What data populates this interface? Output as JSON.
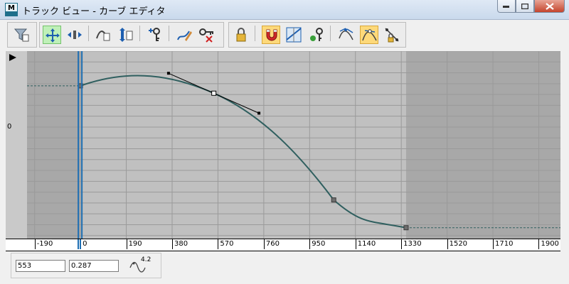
{
  "window": {
    "title": "トラック ビュー - カーブ エディタ",
    "icon_letter": "M"
  },
  "toolbar": {
    "groups": [
      [
        "filter-icon"
      ],
      [
        "move-keys-icon",
        "slide-keys-icon",
        "scale-keys-icon",
        "scale-values-icon",
        "add-keys-icon",
        "draw-curves-icon",
        "reduce-keys-icon"
      ],
      [
        "lock-selection-icon",
        "snap-frames-icon",
        "parameter-curve-icon",
        "show-keyable-icon",
        "show-all-tangents-icon",
        "show-tangents-icon",
        "lock-tangents-icon"
      ]
    ],
    "active": [
      "move-keys-icon",
      "snap-frames-icon",
      "show-tangents-icon"
    ]
  },
  "graph": {
    "zero_label": "0",
    "x_range": [
      -310,
      1990
    ],
    "y_range": [
      210,
      -222
    ],
    "keys": [
      {
        "frame": 0,
        "value": 130
      },
      {
        "frame": 553,
        "value": 113
      },
      {
        "frame": 1050,
        "value": -133
      },
      {
        "frame": 1350,
        "value": -197
      }
    ],
    "selected_key": {
      "frame": 553,
      "value": 113,
      "in_handle": {
        "frame": 365,
        "value": 159
      },
      "out_handle": {
        "frame": 740,
        "value": 67
      }
    },
    "active_range": [
      0,
      1350
    ],
    "current_frame": 0,
    "colors": {
      "curve": "#2f5f5f",
      "range_bg": "#c0c0c0",
      "outside_bg": "#a8a8a8",
      "timeslider": "#1f6fb3"
    }
  },
  "ruler": {
    "ticks": [
      "-190",
      "0",
      "190",
      "380",
      "570",
      "760",
      "950",
      "1140",
      "1330",
      "1520",
      "1710",
      "1900"
    ]
  },
  "status": {
    "frame_value": "553",
    "value_value": "0.287",
    "icon_label": "4.2"
  }
}
